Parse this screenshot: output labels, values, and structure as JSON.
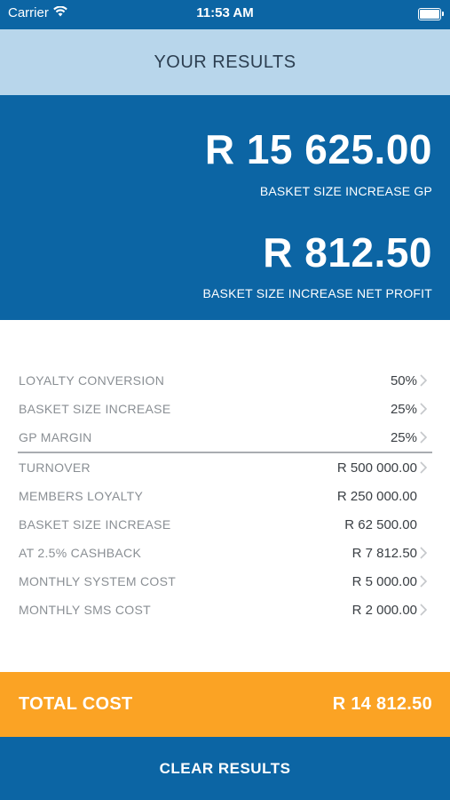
{
  "status_bar": {
    "carrier": "Carrier",
    "time": "11:53 AM",
    "icons": [
      "wifi-icon",
      "battery-icon"
    ]
  },
  "header": {
    "title": "YOUR RESULTS"
  },
  "results": {
    "gp_amount": "R 15 625.00",
    "gp_label": "BASKET SIZE INCREASE GP",
    "net_amount": "R 812.50",
    "net_label": "BASKET SIZE INCREASE NET PROFIT"
  },
  "inputs": [
    {
      "label": "LOYALTY CONVERSION",
      "value": "50%",
      "chevron": true
    },
    {
      "label": "BASKET SIZE INCREASE",
      "value": "25%",
      "chevron": true
    },
    {
      "label": "GP MARGIN",
      "value": "25%",
      "chevron": true
    }
  ],
  "breakdown": [
    {
      "label": "TURNOVER",
      "value": "R 500 000.00",
      "chevron": true
    },
    {
      "label": "MEMBERS LOYALTY",
      "value": "R 250 000.00",
      "chevron": false
    },
    {
      "label": "BASKET SIZE INCREASE",
      "value": "R 62 500.00",
      "chevron": false
    },
    {
      "label": "AT 2.5% CASHBACK",
      "value": "R 7 812.50",
      "chevron": true
    },
    {
      "label": "MONTHLY SYSTEM COST",
      "value": "R 5 000.00",
      "chevron": true
    },
    {
      "label": "MONTHLY SMS COST",
      "value": "R 2 000.00",
      "chevron": true
    }
  ],
  "total": {
    "label": "TOTAL COST",
    "value": "R 14 812.50"
  },
  "actions": {
    "clear_label": "CLEAR RESULTS"
  },
  "colors": {
    "primary_blue": "#0c65a4",
    "header_light_blue": "#b8d6eb",
    "total_orange": "#fba324",
    "label_gray": "#8a8f94"
  }
}
